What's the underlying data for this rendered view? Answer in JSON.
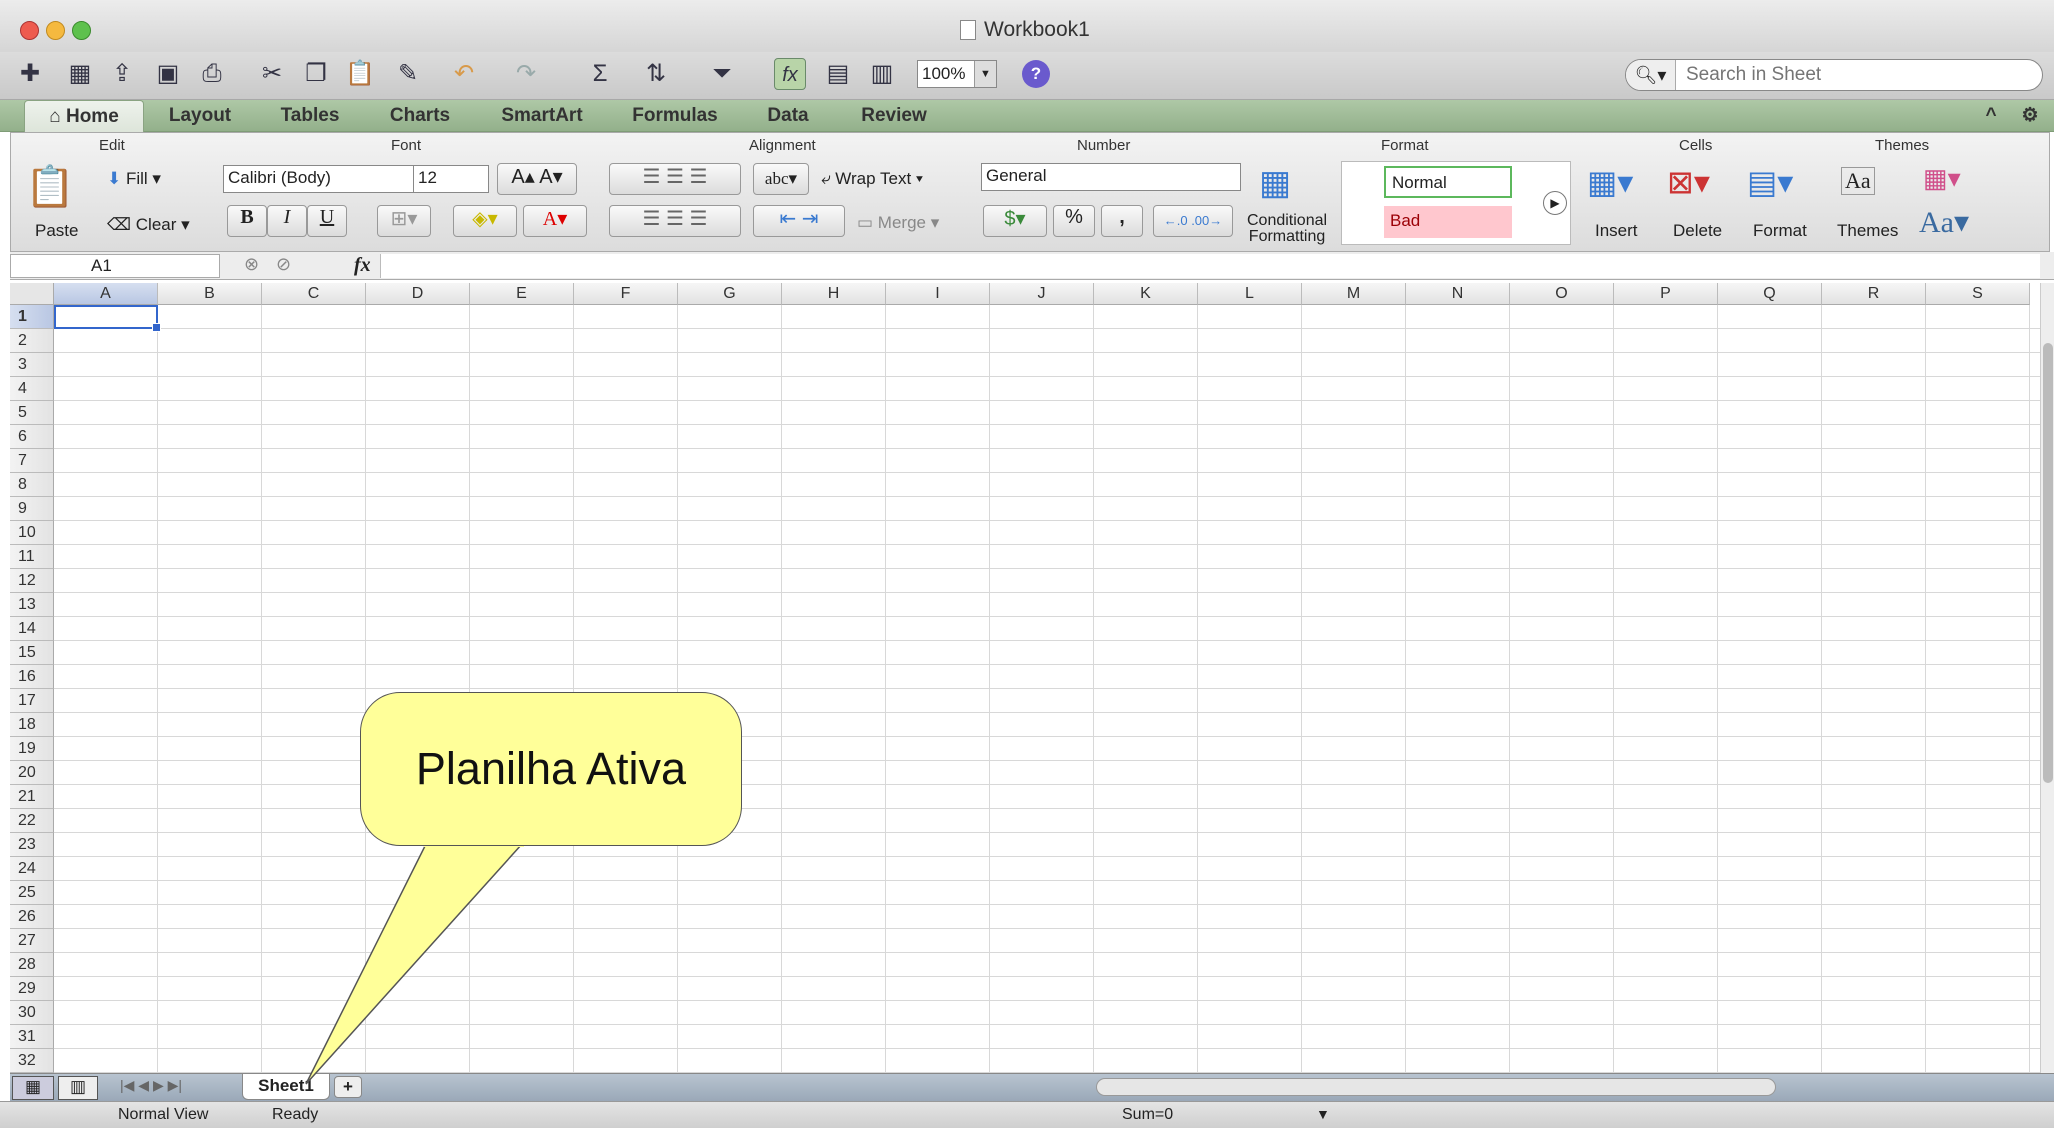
{
  "window": {
    "title": "Workbook1"
  },
  "toolbar": {
    "zoom": "100%",
    "search_placeholder": "Search in Sheet"
  },
  "tabs": [
    "Home",
    "Layout",
    "Tables",
    "Charts",
    "SmartArt",
    "Formulas",
    "Data",
    "Review"
  ],
  "ribbon": {
    "groups": {
      "edit": "Edit",
      "font": "Font",
      "alignment": "Alignment",
      "number": "Number",
      "format": "Format",
      "cells": "Cells",
      "themes": "Themes"
    },
    "paste": "Paste",
    "fill": "Fill",
    "clear": "Clear",
    "font_name": "Calibri (Body)",
    "font_size": "12",
    "bold": "B",
    "italic": "I",
    "underline": "U",
    "wrap_text": "Wrap Text",
    "merge": "Merge",
    "abc": "abc",
    "number_format": "General",
    "percent": "%",
    "comma": ",",
    "cond_format_1": "Conditional",
    "cond_format_2": "Formatting",
    "style_normal": "Normal",
    "style_bad": "Bad",
    "insert": "Insert",
    "delete": "Delete",
    "format": "Format",
    "themes": "Themes",
    "themes_aa": "Aa"
  },
  "formula_bar": {
    "name_box": "A1",
    "fx": "fx"
  },
  "columns": [
    "A",
    "B",
    "C",
    "D",
    "E",
    "F",
    "G",
    "H",
    "I",
    "J",
    "K",
    "L",
    "M",
    "N",
    "O",
    "P",
    "Q",
    "R",
    "S"
  ],
  "rows": [
    "1",
    "2",
    "3",
    "4",
    "5",
    "6",
    "7",
    "8",
    "9",
    "10",
    "11",
    "12",
    "13",
    "14",
    "15",
    "16",
    "17",
    "18",
    "19",
    "20",
    "21",
    "22",
    "23",
    "24",
    "25",
    "26",
    "27",
    "28",
    "29",
    "30",
    "31",
    "32"
  ],
  "sheet_tab": "Sheet1",
  "status": {
    "view": "Normal View",
    "state": "Ready",
    "sum": "Sum=0"
  },
  "callout": "Planilha Ativa",
  "colors": {
    "tab_bar": "#a5c09c",
    "callout_fill": "#ffff99",
    "active_cell_border": "#3366cc",
    "bad_fill": "#ffc7ce",
    "normal_border": "#5cb85c"
  }
}
